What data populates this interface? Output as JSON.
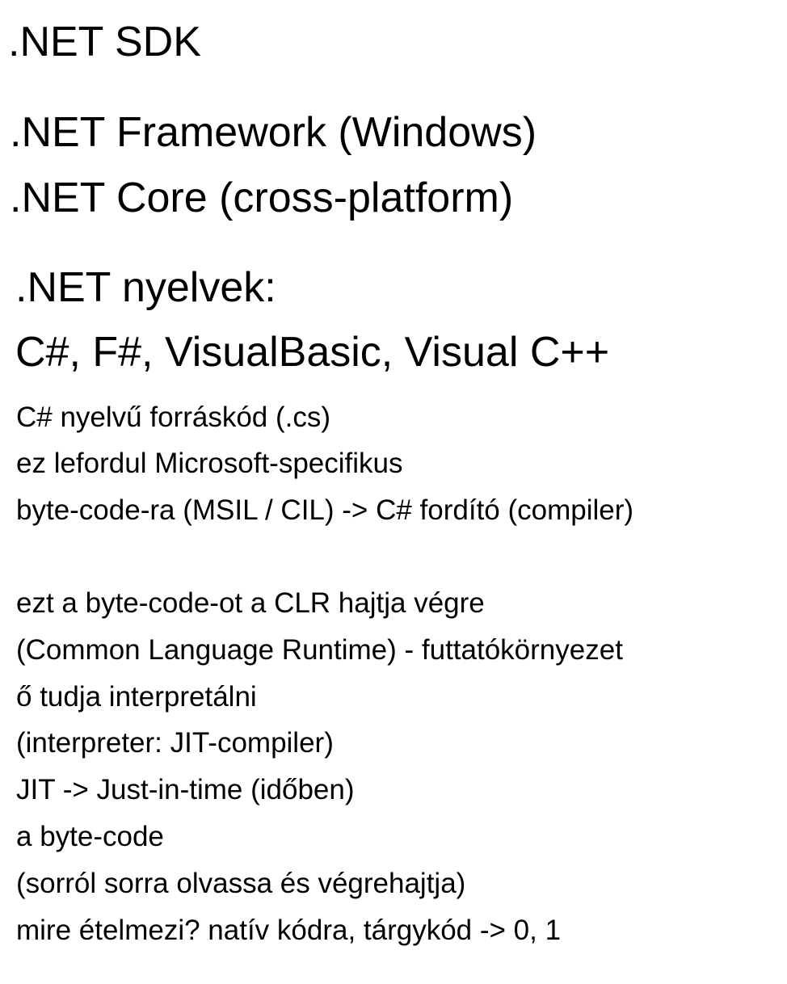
{
  "headings": {
    "sdk": ".NET SDK",
    "framework": ".NET Framework (Windows)",
    "core": ".NET Core (cross-platform)",
    "languages_title": ".NET nyelvek:",
    "languages_list": "C#, F#, VisualBasic, Visual C++"
  },
  "notes": {
    "source_code": "C# nyelvű forráskód (.cs)",
    "compiles": "ez lefordul Microsoft-specifikus",
    "bytecode": "byte-code-ra (MSIL / CIL) -> C# fordító (compiler)",
    "clr_runs": "ezt a byte-code-ot a CLR hajtja végre",
    "clr_full": "(Common Language Runtime) - futtatókörnyezet",
    "interpret": "ő tudja interpretálni",
    "interpreter": "(interpreter: JIT-compiler)",
    "jit": "JIT -> Just-in-time (időben)",
    "bytecode_line": "a byte-code",
    "line_by_line": "(sorról sorra olvassa és végrehajtja)",
    "native": "mire ételmezi? natív kódra, tárgykód -> 0, 1"
  }
}
